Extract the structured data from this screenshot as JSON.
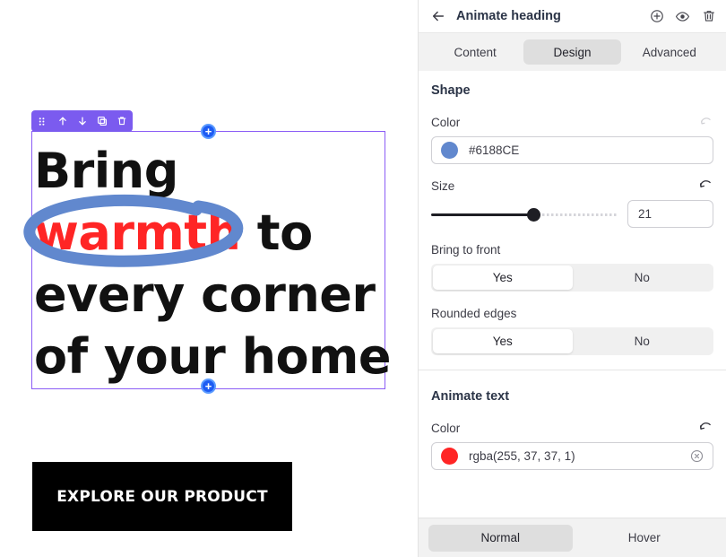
{
  "canvas": {
    "element_toolbar": {
      "icons": [
        "drag-handle-icon",
        "move-up-icon",
        "move-down-icon",
        "duplicate-icon",
        "delete-icon"
      ]
    },
    "heading": {
      "line1": "Bring",
      "highlight": "warmth",
      "after_highlight": " to",
      "line3": "every corner",
      "line4": "of your home",
      "full_text": "Bring warmth to every corner of your home",
      "text_color": "#111111",
      "highlight_color": "#FF2525",
      "scribble_color": "#6188CE"
    },
    "cta": {
      "label": "EXPLORE OUR PRODUCT",
      "bg": "#000000",
      "color": "#FFFFFF"
    },
    "selection": {
      "border_color": "#8B5CF6",
      "handle_color": "#1E5CF3",
      "handle_glyph": "+"
    }
  },
  "panel": {
    "header": {
      "back_icon": "arrow-left-icon",
      "title": "Animate heading",
      "icons": [
        "add-circle-icon",
        "eye-icon",
        "trash-icon"
      ]
    },
    "tabs": [
      {
        "label": "Content",
        "active": false
      },
      {
        "label": "Design",
        "active": true
      },
      {
        "label": "Advanced",
        "active": false
      }
    ],
    "shape": {
      "title": "Shape",
      "color": {
        "label": "Color",
        "value": "#6188CE",
        "swatch": "#6188CE",
        "reset_icon": "reset-icon",
        "reset_enabled": false
      },
      "size": {
        "label": "Size",
        "value": "21",
        "percent": 55,
        "reset_icon": "reset-icon",
        "reset_enabled": true
      },
      "bring_to_front": {
        "label": "Bring to front",
        "options": [
          "Yes",
          "No"
        ],
        "selected": "Yes"
      },
      "rounded_edges": {
        "label": "Rounded edges",
        "options": [
          "Yes",
          "No"
        ],
        "selected": "Yes"
      }
    },
    "animate_text": {
      "title": "Animate text",
      "color": {
        "label": "Color",
        "value": "rgba(255, 37, 37, 1)",
        "swatch": "#FF2525",
        "reset_icon": "reset-icon",
        "clear_icon": "clear-circle-icon"
      }
    },
    "state_tabs": [
      {
        "label": "Normal",
        "active": true
      },
      {
        "label": "Hover",
        "active": false
      }
    ]
  }
}
